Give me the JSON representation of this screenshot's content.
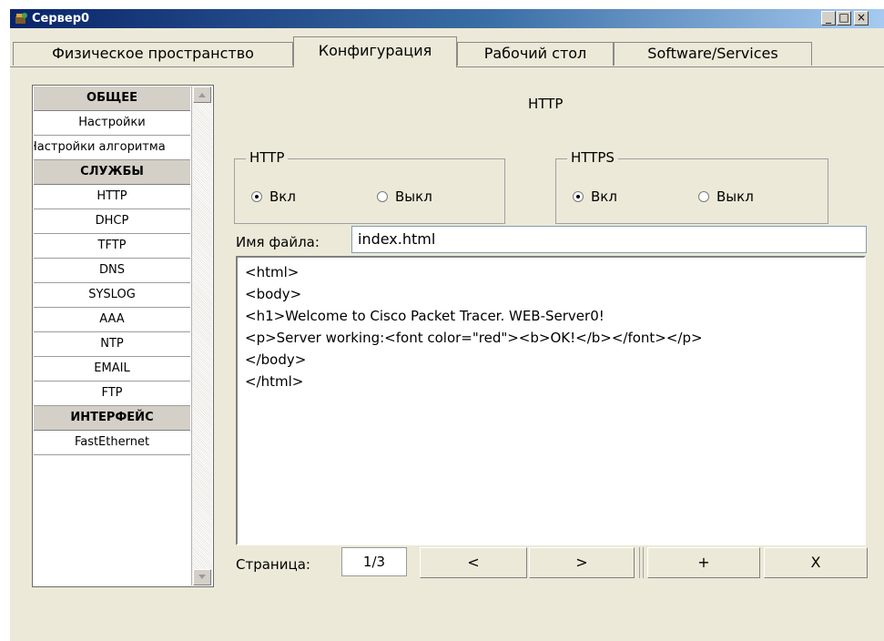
{
  "window": {
    "title": "Сервер0",
    "minimize": "_",
    "maximize": "□",
    "close": "×"
  },
  "tabs": [
    {
      "label": "Физическое пространство"
    },
    {
      "label": "Конфигурация"
    },
    {
      "label": "Рабочий стол"
    },
    {
      "label": "Software/Services"
    }
  ],
  "sidebar": {
    "items": [
      {
        "label": "ОБЩЕЕ",
        "kind": "header"
      },
      {
        "label": "Настройки",
        "kind": "item"
      },
      {
        "label": "Настройки алгоритма",
        "kind": "item"
      },
      {
        "label": "СЛУЖБЫ",
        "kind": "header"
      },
      {
        "label": "HTTP",
        "kind": "item"
      },
      {
        "label": "DHCP",
        "kind": "item"
      },
      {
        "label": "TFTP",
        "kind": "item"
      },
      {
        "label": "DNS",
        "kind": "item"
      },
      {
        "label": "SYSLOG",
        "kind": "item"
      },
      {
        "label": "AAA",
        "kind": "item"
      },
      {
        "label": "NTP",
        "kind": "item"
      },
      {
        "label": "EMAIL",
        "kind": "item"
      },
      {
        "label": "FTP",
        "kind": "item"
      },
      {
        "label": "ИНТЕРФЕЙС",
        "kind": "header"
      },
      {
        "label": "FastEthernet",
        "kind": "item"
      }
    ]
  },
  "panel": {
    "heading": "HTTP",
    "http_group": {
      "legend": "HTTP",
      "on_label": "Вкл",
      "off_label": "Выкл",
      "selected": "on"
    },
    "https_group": {
      "legend": "HTTPS",
      "on_label": "Вкл",
      "off_label": "Выкл",
      "selected": "on"
    },
    "filename_label": "Имя файла:",
    "filename_value": "index.html",
    "editor_lines": [
      "<html>",
      "<body>",
      "<h1>Welcome to Cisco Packet Tracer. WEB-Server0!",
      "<p>Server working:<font color=\"red\"><b>OK!</b></font></p>",
      "</body>",
      "</html>"
    ],
    "pager": {
      "label": "Страница:",
      "value": "1/3",
      "prev": "<",
      "next": ">",
      "add": "+",
      "remove": "X"
    }
  }
}
